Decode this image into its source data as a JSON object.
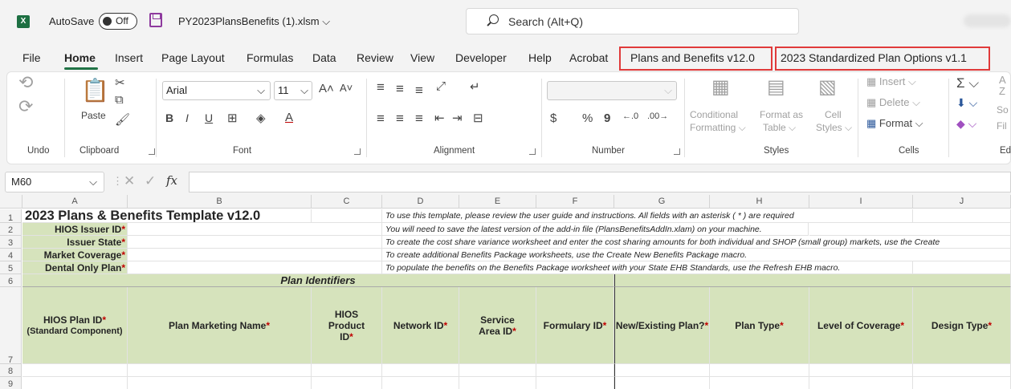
{
  "titlebar": {
    "app_logo": "X",
    "autosave_label": "AutoSave",
    "autosave_state": "Off",
    "filename": "PY2023PlansBenefits (1).xlsm ⌵",
    "search_placeholder": "Search (Alt+Q)"
  },
  "menu": {
    "items": [
      "File",
      "Home",
      "Insert",
      "Page Layout",
      "Formulas",
      "Data",
      "Review",
      "View",
      "Developer",
      "Help",
      "Acrobat",
      "Plans and Benefits v12.0",
      "2023 Standardized Plan Options v1.1"
    ],
    "active": "Home"
  },
  "ribbon": {
    "groups": [
      "Undo",
      "Clipboard",
      "Font",
      "Alignment",
      "Number",
      "Styles",
      "Cells",
      "Ed"
    ],
    "paste": "Paste",
    "font_name": "Arial",
    "font_size": "11",
    "bold": "B",
    "italic": "I",
    "underline": "U",
    "cond_fmt": "Conditional",
    "cond_fmt2": "Formatting ⌵",
    "fmt_table": "Format as",
    "fmt_table2": "Table ⌵",
    "cell_styles": "Cell",
    "cell_styles2": "Styles ⌵",
    "insert": "Insert",
    "delete": "Delete",
    "format": "Format",
    "number_symbols": [
      "$",
      "%",
      "9"
    ],
    "editing_partial": [
      "A",
      "Z",
      "So",
      "Fil"
    ]
  },
  "formula_bar": {
    "name_box": "M60",
    "fx": "fx",
    "value": ""
  },
  "columns": [
    "A",
    "B",
    "C",
    "D",
    "E",
    "F",
    "G",
    "H",
    "I",
    "J"
  ],
  "rows": [
    "1",
    "2",
    "3",
    "4",
    "5",
    "6",
    "7",
    "8",
    "9"
  ],
  "sheet": {
    "title": "2023 Plans & Benefits Template v12.0",
    "labels": [
      {
        "text": "HIOS Issuer ID",
        "req": "*"
      },
      {
        "text": "Issuer State",
        "req": "*"
      },
      {
        "text": "Market Coverage",
        "req": "*"
      },
      {
        "text": "Dental Only Plan",
        "req": "*"
      }
    ],
    "notes": [
      "To use this template, please review the user guide and instructions. All fields with an asterisk ( * ) are required",
      "You will need to save the latest version of the add-in file (PlansBenefitsAddIn.xlam) on your machine.",
      "To create the cost share variance worksheet and enter the cost sharing amounts for both individual and SHOP (small group) markets, use the Create",
      "To create additional Benefits Package worksheets, use the Create New Benefits Package macro.",
      "To populate the benefits on the Benefits Package worksheet with your State EHB Standards, use the Refresh EHB macro."
    ],
    "section": "Plan Identifiers",
    "headers": [
      {
        "text": "HIOS Plan ID",
        "req": "*",
        "sub": "(Standard Component)"
      },
      {
        "text": "Plan Marketing Name",
        "req": "*",
        "sub": ""
      },
      {
        "text": "HIOS Product ID",
        "req": "*",
        "sub": ""
      },
      {
        "text": "Network ID",
        "req": "*",
        "sub": ""
      },
      {
        "text": "Service Area ID",
        "req": "*",
        "sub": ""
      },
      {
        "text": "Formulary ID",
        "req": "*",
        "sub": ""
      },
      {
        "text": "New/Existing Plan?",
        "req": "*",
        "sub": ""
      },
      {
        "text": "Plan Type",
        "req": "*",
        "sub": ""
      },
      {
        "text": "Level of Coverage",
        "req": "*",
        "sub": ""
      },
      {
        "text": "Design Type",
        "req": "*",
        "sub": ""
      }
    ]
  },
  "colors": {
    "accent": "#217346",
    "header_fill": "#d6e3bc",
    "required": "#c00000",
    "highlight_box": "#e03a3a"
  }
}
